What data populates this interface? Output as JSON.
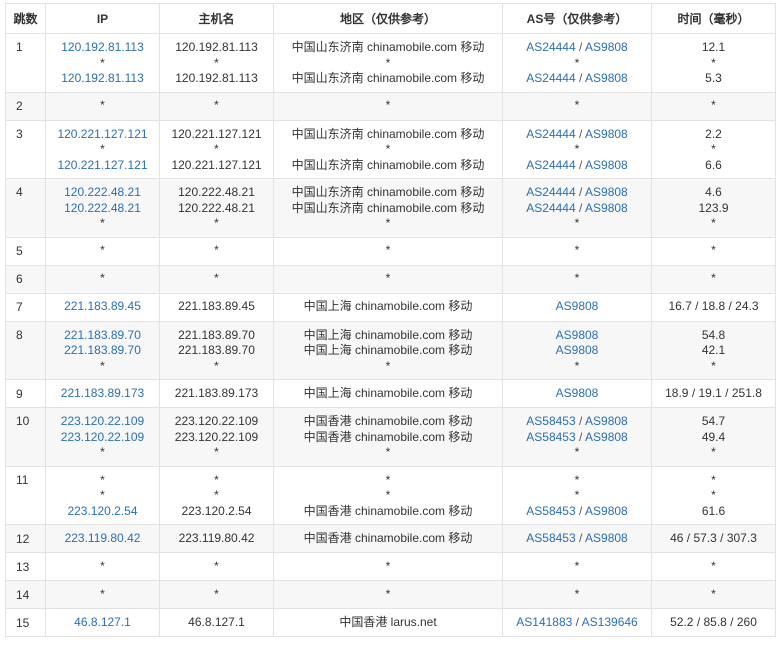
{
  "headers": {
    "hop": "跳数",
    "ip": "IP",
    "host": "主机名",
    "region": "地区（仅供参考）",
    "as": "AS号（仅供参考）",
    "time": "时间（毫秒）"
  },
  "rows": [
    {
      "hop": "1",
      "shaded": false,
      "lines": [
        {
          "ip": "120.192.81.113",
          "host": "120.192.81.113",
          "region": "中国山东济南 chinamobile.com 移动",
          "as": [
            "AS24444",
            "AS9808"
          ],
          "time": "12.1"
        },
        {
          "ip": "*",
          "host": "*",
          "region": "*",
          "as": [
            "*"
          ],
          "time": "*"
        },
        {
          "ip": "120.192.81.113",
          "host": "120.192.81.113",
          "region": "中国山东济南 chinamobile.com 移动",
          "as": [
            "AS24444",
            "AS9808"
          ],
          "time": "5.3"
        }
      ]
    },
    {
      "hop": "2",
      "shaded": true,
      "lines": [
        {
          "ip": "*",
          "host": "*",
          "region": "*",
          "as": [
            "*"
          ],
          "time": "*"
        }
      ]
    },
    {
      "hop": "3",
      "shaded": false,
      "lines": [
        {
          "ip": "120.221.127.121",
          "host": "120.221.127.121",
          "region": "中国山东济南 chinamobile.com 移动",
          "as": [
            "AS24444",
            "AS9808"
          ],
          "time": "2.2"
        },
        {
          "ip": "*",
          "host": "*",
          "region": "*",
          "as": [
            "*"
          ],
          "time": "*"
        },
        {
          "ip": "120.221.127.121",
          "host": "120.221.127.121",
          "region": "中国山东济南 chinamobile.com 移动",
          "as": [
            "AS24444",
            "AS9808"
          ],
          "time": "6.6"
        }
      ]
    },
    {
      "hop": "4",
      "shaded": true,
      "lines": [
        {
          "ip": "120.222.48.21",
          "host": "120.222.48.21",
          "region": "中国山东济南 chinamobile.com 移动",
          "as": [
            "AS24444",
            "AS9808"
          ],
          "time": "4.6"
        },
        {
          "ip": "120.222.48.21",
          "host": "120.222.48.21",
          "region": "中国山东济南 chinamobile.com 移动",
          "as": [
            "AS24444",
            "AS9808"
          ],
          "time": "123.9"
        },
        {
          "ip": "*",
          "host": "*",
          "region": "*",
          "as": [
            "*"
          ],
          "time": "*"
        }
      ]
    },
    {
      "hop": "5",
      "shaded": false,
      "lines": [
        {
          "ip": "*",
          "host": "*",
          "region": "*",
          "as": [
            "*"
          ],
          "time": "*"
        }
      ]
    },
    {
      "hop": "6",
      "shaded": true,
      "lines": [
        {
          "ip": "*",
          "host": "*",
          "region": "*",
          "as": [
            "*"
          ],
          "time": "*"
        }
      ]
    },
    {
      "hop": "7",
      "shaded": false,
      "lines": [
        {
          "ip": "221.183.89.45",
          "host": "221.183.89.45",
          "region": "中国上海 chinamobile.com 移动",
          "as": [
            "AS9808"
          ],
          "time": "16.7 / 18.8 / 24.3"
        }
      ]
    },
    {
      "hop": "8",
      "shaded": true,
      "lines": [
        {
          "ip": "221.183.89.70",
          "host": "221.183.89.70",
          "region": "中国上海 chinamobile.com 移动",
          "as": [
            "AS9808"
          ],
          "time": "54.8"
        },
        {
          "ip": "221.183.89.70",
          "host": "221.183.89.70",
          "region": "中国上海 chinamobile.com 移动",
          "as": [
            "AS9808"
          ],
          "time": "42.1"
        },
        {
          "ip": "*",
          "host": "*",
          "region": "*",
          "as": [
            "*"
          ],
          "time": "*"
        }
      ]
    },
    {
      "hop": "9",
      "shaded": false,
      "lines": [
        {
          "ip": "221.183.89.173",
          "host": "221.183.89.173",
          "region": "中国上海 chinamobile.com 移动",
          "as": [
            "AS9808"
          ],
          "time": "18.9 / 19.1 / 251.8"
        }
      ]
    },
    {
      "hop": "10",
      "shaded": true,
      "lines": [
        {
          "ip": "223.120.22.109",
          "host": "223.120.22.109",
          "region": "中国香港 chinamobile.com 移动",
          "as": [
            "AS58453",
            "AS9808"
          ],
          "time": "54.7"
        },
        {
          "ip": "223.120.22.109",
          "host": "223.120.22.109",
          "region": "中国香港 chinamobile.com 移动",
          "as": [
            "AS58453",
            "AS9808"
          ],
          "time": "49.4"
        },
        {
          "ip": "*",
          "host": "*",
          "region": "*",
          "as": [
            "*"
          ],
          "time": "*"
        }
      ]
    },
    {
      "hop": "11",
      "shaded": false,
      "lines": [
        {
          "ip": "*",
          "host": "*",
          "region": "*",
          "as": [
            "*"
          ],
          "time": "*"
        },
        {
          "ip": "*",
          "host": "*",
          "region": "*",
          "as": [
            "*"
          ],
          "time": "*"
        },
        {
          "ip": "223.120.2.54",
          "host": "223.120.2.54",
          "region": "中国香港 chinamobile.com 移动",
          "as": [
            "AS58453",
            "AS9808"
          ],
          "time": "61.6"
        }
      ]
    },
    {
      "hop": "12",
      "shaded": true,
      "lines": [
        {
          "ip": "223.119.80.42",
          "host": "223.119.80.42",
          "region": "中国香港 chinamobile.com 移动",
          "as": [
            "AS58453",
            "AS9808"
          ],
          "time": "46 / 57.3 / 307.3"
        }
      ]
    },
    {
      "hop": "13",
      "shaded": false,
      "lines": [
        {
          "ip": "*",
          "host": "*",
          "region": "*",
          "as": [
            "*"
          ],
          "time": "*"
        }
      ]
    },
    {
      "hop": "14",
      "shaded": true,
      "lines": [
        {
          "ip": "*",
          "host": "*",
          "region": "*",
          "as": [
            "*"
          ],
          "time": "*"
        }
      ]
    },
    {
      "hop": "15",
      "shaded": false,
      "lines": [
        {
          "ip": "46.8.127.1",
          "host": "46.8.127.1",
          "region": "中国香港 larus.net",
          "as": [
            "AS141883",
            "AS139646"
          ],
          "time": "52.2 / 85.8 / 260"
        }
      ]
    }
  ]
}
